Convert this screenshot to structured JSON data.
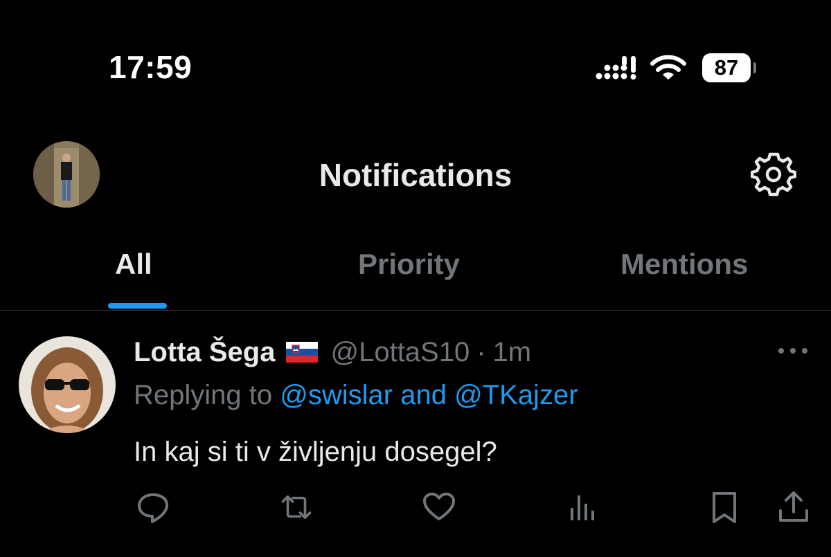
{
  "status_bar": {
    "time": "17:59",
    "battery": "87"
  },
  "header": {
    "title": "Notifications"
  },
  "tabs": [
    {
      "label": "All",
      "active": true
    },
    {
      "label": "Priority",
      "active": false
    },
    {
      "label": "Mentions",
      "active": false
    }
  ],
  "tweet": {
    "author_name": "Lotta Šega",
    "handle": "@LottaS10",
    "separator": "·",
    "time": "1m",
    "reply_prefix": "Replying to",
    "reply_mention_1": "@swislar",
    "reply_and": "and",
    "reply_mention_2": "@TKajzer",
    "text": "In kaj si ti v življenju dosegel?",
    "actions": [
      "reply-icon",
      "retweet-icon",
      "like-icon",
      "views-icon",
      "bookmark-icon",
      "share-icon"
    ]
  },
  "colors": {
    "background": "#000000",
    "text_primary": "#e7e9ea",
    "text_secondary": "#71767b",
    "accent": "#1d9bf0",
    "divider": "#2f3336"
  }
}
